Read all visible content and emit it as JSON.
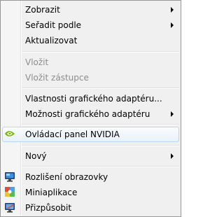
{
  "menu": {
    "items": [
      {
        "label": "Zobrazit",
        "submenu": true,
        "disabled": false
      },
      {
        "label": "Seřadit podle",
        "submenu": true,
        "disabled": false
      },
      {
        "label": "Aktualizovat",
        "submenu": false,
        "disabled": false
      },
      {
        "label": "Vložit",
        "submenu": false,
        "disabled": true
      },
      {
        "label": "Vložit zástupce",
        "submenu": false,
        "disabled": true
      },
      {
        "label": "Vlastnosti grafického adaptéru...",
        "submenu": false,
        "disabled": false
      },
      {
        "label": "Možnosti grafického adaptéru",
        "submenu": true,
        "disabled": false
      },
      {
        "label": "Ovládací panel NVIDIA",
        "submenu": false,
        "disabled": false,
        "icon": "nvidia-icon",
        "highlighted": true
      },
      {
        "label": "Nový",
        "submenu": true,
        "disabled": false
      },
      {
        "label": "Rozlišení obrazovky",
        "submenu": false,
        "disabled": false,
        "icon": "screen-resolution-icon"
      },
      {
        "label": "Miniaplikace",
        "submenu": false,
        "disabled": false,
        "icon": "gadgets-icon"
      },
      {
        "label": "Přizpůsobit",
        "submenu": false,
        "disabled": false,
        "icon": "personalize-icon"
      }
    ]
  },
  "colors": {
    "highlight_border": "#b8d6fb",
    "disabled_text": "#8c8c8c",
    "nvidia_green": "#76b900"
  }
}
